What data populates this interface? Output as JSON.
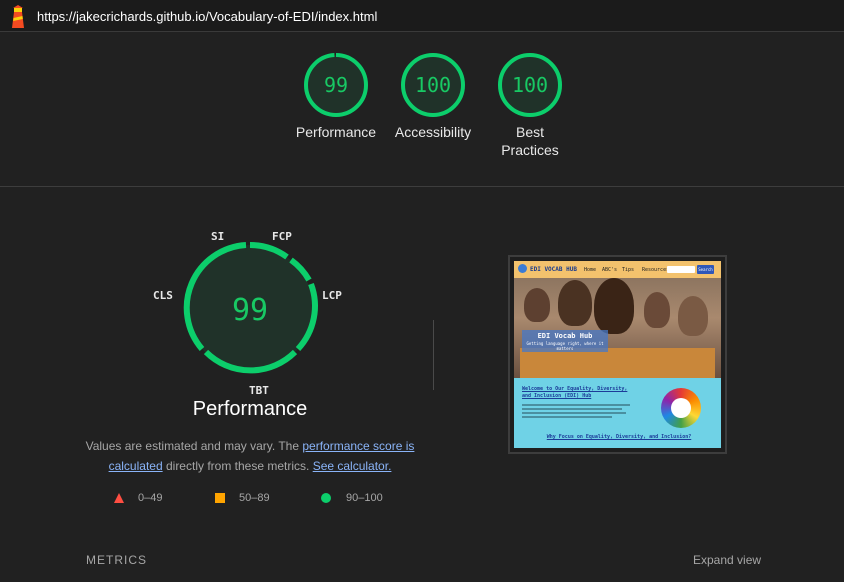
{
  "header": {
    "url": "https://jakecrichards.github.io/Vocabulary-of-EDI/index.html",
    "logo_icon": "lighthouse-icon"
  },
  "gauges": [
    {
      "score": "99",
      "label": "Performance",
      "fraction": 0.99
    },
    {
      "score": "100",
      "label": "Accessibility",
      "fraction": 1.0
    },
    {
      "score": "100",
      "label": "Best Practices",
      "fraction": 1.0
    }
  ],
  "perf": {
    "score": "99",
    "title": "Performance",
    "metric_tags": {
      "si": "SI",
      "fcp": "FCP",
      "lcp": "LCP",
      "tbt": "TBT",
      "cls": "CLS"
    },
    "desc_prefix": "Values are estimated and may vary. The ",
    "desc_link1": "performance score is calculated",
    "desc_middle": " directly from these metrics. ",
    "desc_link2": "See calculator."
  },
  "legend": [
    {
      "range": "0–49",
      "shape": "triangle",
      "color": "#ff4e42"
    },
    {
      "range": "50–89",
      "shape": "square",
      "color": "#ffa400"
    },
    {
      "range": "90–100",
      "shape": "circle",
      "color": "#0cce6b"
    }
  ],
  "thumbnail": {
    "site_name": "EDI VOCAB HUB",
    "nav_items": [
      "Home",
      "ABC's",
      "Tips",
      "Resources"
    ],
    "search_button": "Search",
    "hero_title": "EDI Vocab Hub",
    "hero_tagline": "Getting language right, where it matters",
    "section_title": "Welcome to Our Equality, Diversity, and Inclusion (EDI) Hub",
    "section_subtitle": "Why Focus on Equality, Diversity, and Inclusion?"
  },
  "footer": {
    "metrics_label": "METRICS",
    "expand_label": "Expand view"
  },
  "colors": {
    "pass": "#0cce6b",
    "pass_text": "#18c964",
    "background": "#212121"
  }
}
